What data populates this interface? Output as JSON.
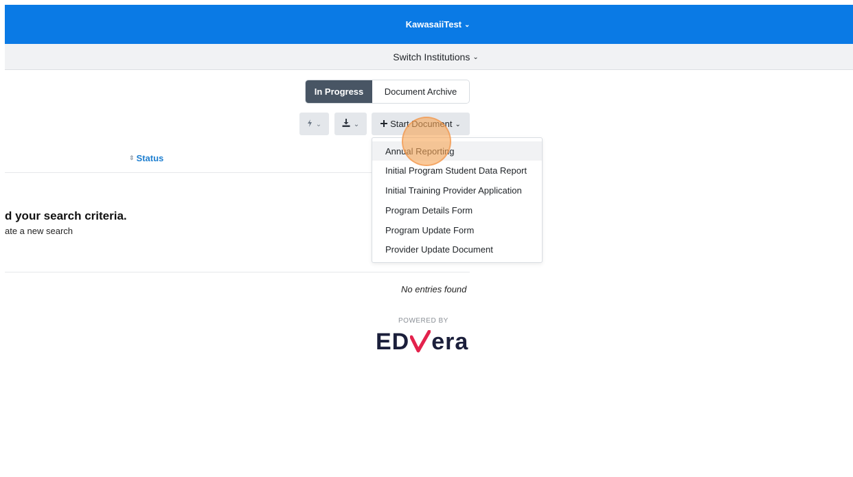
{
  "topbar": {
    "institution": "KawasaiiTest",
    "chevron": "⌄",
    "color": "#0a7ae5"
  },
  "switchbar": {
    "label": "Switch Institutions"
  },
  "tabs": [
    {
      "label": "In Progress",
      "active": true
    },
    {
      "label": "Document Archive",
      "active": false
    }
  ],
  "toolbar": {
    "action_icon": "lightning-icon",
    "download_icon": "download-icon",
    "start_label": "Start Document",
    "start_icon": "plus-icon"
  },
  "table": {
    "status_header": "Status"
  },
  "empty_state": {
    "title": "d your search criteria.",
    "subtitle": "ate a new search"
  },
  "no_entries": "No entries found",
  "footer": {
    "powered_by": "POWERED BY",
    "logo_left": "ED",
    "logo_right": "era",
    "logo_mark_color": "#e3224c"
  },
  "dropdown": {
    "items": [
      "Annual Reporting",
      "Initial Program Student Data Report",
      "Initial Training Provider Application",
      "Program Details Form",
      "Program Update Form",
      "Provider Update Document"
    ],
    "hovered": "Annual Reporting"
  }
}
